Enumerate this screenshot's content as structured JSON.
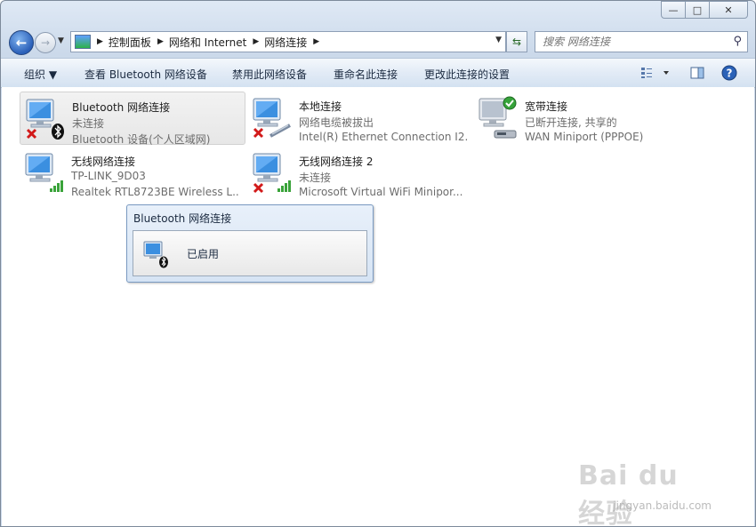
{
  "window": {
    "minimize_label": "—",
    "maximize_label": "□",
    "close_label": "✕"
  },
  "address": {
    "crumbs": [
      "控制面板",
      "网络和 Internet",
      "网络连接"
    ],
    "search_placeholder": "搜索 网络连接"
  },
  "toolbar": {
    "organize": "组织 ▼",
    "view_bluetooth": "查看 Bluetooth 网络设备",
    "disable_device": "禁用此网络设备",
    "rename": "重命名此连接",
    "change_settings": "更改此连接的设置"
  },
  "connections": [
    {
      "name": "Bluetooth 网络连接",
      "status": "未连接",
      "device": "Bluetooth 设备(个人区域网)",
      "badge": "bluetooth-icon",
      "state": "disconnected"
    },
    {
      "name": "本地连接",
      "status": "网络电缆被拔出",
      "device": "Intel(R) Ethernet Connection I2...",
      "badge": "ethernet-cable-icon",
      "state": "disconnected"
    },
    {
      "name": "宽带连接",
      "status": "已断开连接, 共享的",
      "device": "WAN Miniport (PPPOE)",
      "badge": "modem-icon",
      "state": "shared"
    },
    {
      "name": "无线网络连接",
      "status": "TP-LINK_9D03",
      "device": "Realtek RTL8723BE Wireless L...",
      "badge": "wifi-signal-icon",
      "state": "connected"
    },
    {
      "name": "无线网络连接 2",
      "status": "未连接",
      "device": "Microsoft Virtual WiFi Minipor...",
      "badge": "wifi-signal-icon",
      "state": "disconnected"
    }
  ],
  "tooltip": {
    "title": "Bluetooth 网络连接",
    "text": "已启用"
  },
  "watermark": {
    "brand": "Bai du 经验",
    "url": "jingyan.baidu.com"
  },
  "colors": {
    "accent": "#2a5fb8",
    "error": "#d21a1a",
    "ok": "#36a33a"
  }
}
